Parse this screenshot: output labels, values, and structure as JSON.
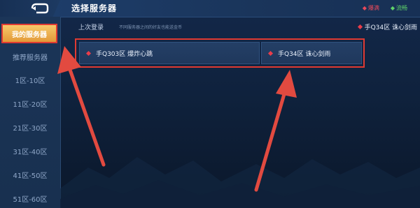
{
  "header": {
    "title": "选择服务器",
    "status": [
      {
        "label": "爆满",
        "color": "#e8495a"
      },
      {
        "label": "流畅",
        "color": "#5fd36a"
      }
    ]
  },
  "sidebar": {
    "items": [
      {
        "label": "我的服务器",
        "active": true
      },
      {
        "label": "推荐服务器",
        "active": false
      },
      {
        "label": "1区-10区",
        "active": false
      },
      {
        "label": "11区-20区",
        "active": false
      },
      {
        "label": "21区-30区",
        "active": false
      },
      {
        "label": "31区-40区",
        "active": false
      },
      {
        "label": "41区-50区",
        "active": false
      },
      {
        "label": "51区-60区",
        "active": false
      }
    ]
  },
  "subrow": {
    "last_login_label": "上次登录",
    "hint": "不同服务器之间的好友也能送金币",
    "last_server": "手Q34区 诛心剑雨"
  },
  "servers": [
    {
      "name": "手Q303区 爆炸心跳",
      "status_color": "#ea3d4a"
    },
    {
      "name": "手Q34区 诛心剑雨",
      "status_color": "#ea3d4a"
    }
  ],
  "colors": {
    "accent_red": "#e03a32",
    "active_tab": "#e39a38",
    "arrow": "#e24a40"
  }
}
